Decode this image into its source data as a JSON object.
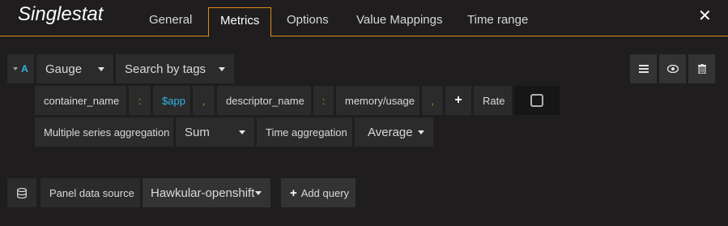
{
  "panel": {
    "title": "Singlestat"
  },
  "tabs": [
    {
      "label": "General"
    },
    {
      "label": "Metrics"
    },
    {
      "label": "Options"
    },
    {
      "label": "Value Mappings"
    },
    {
      "label": "Time range"
    }
  ],
  "query": {
    "ref_id": "A",
    "mode": "Gauge",
    "search_by": "Search by tags",
    "tags": {
      "key1": "container_name",
      "sep1": ":",
      "value1": "$app",
      "comma1": ",",
      "key2": "descriptor_name",
      "sep2": ":",
      "value2": "memory/usage",
      "comma2": ","
    },
    "add_tag_symbol": "+",
    "rate_label": "Rate",
    "rate_checked": false,
    "series_agg_label": "Multiple series aggregation",
    "series_agg_value": "Sum",
    "time_agg_label": "Time aggregation",
    "time_agg_value": "Average"
  },
  "actions": {
    "menu_icon": "hamburger-icon",
    "eye_icon": "eye-icon",
    "trash_icon": "trash-icon"
  },
  "datasource": {
    "icon": "database-icon",
    "label": "Panel data source",
    "value": "Hawkular-openshift",
    "add_query_label": "Add query"
  },
  "colors": {
    "accent": "#e08a1e",
    "ref_id": "#33b5e5",
    "background": "#1f1d1d"
  }
}
